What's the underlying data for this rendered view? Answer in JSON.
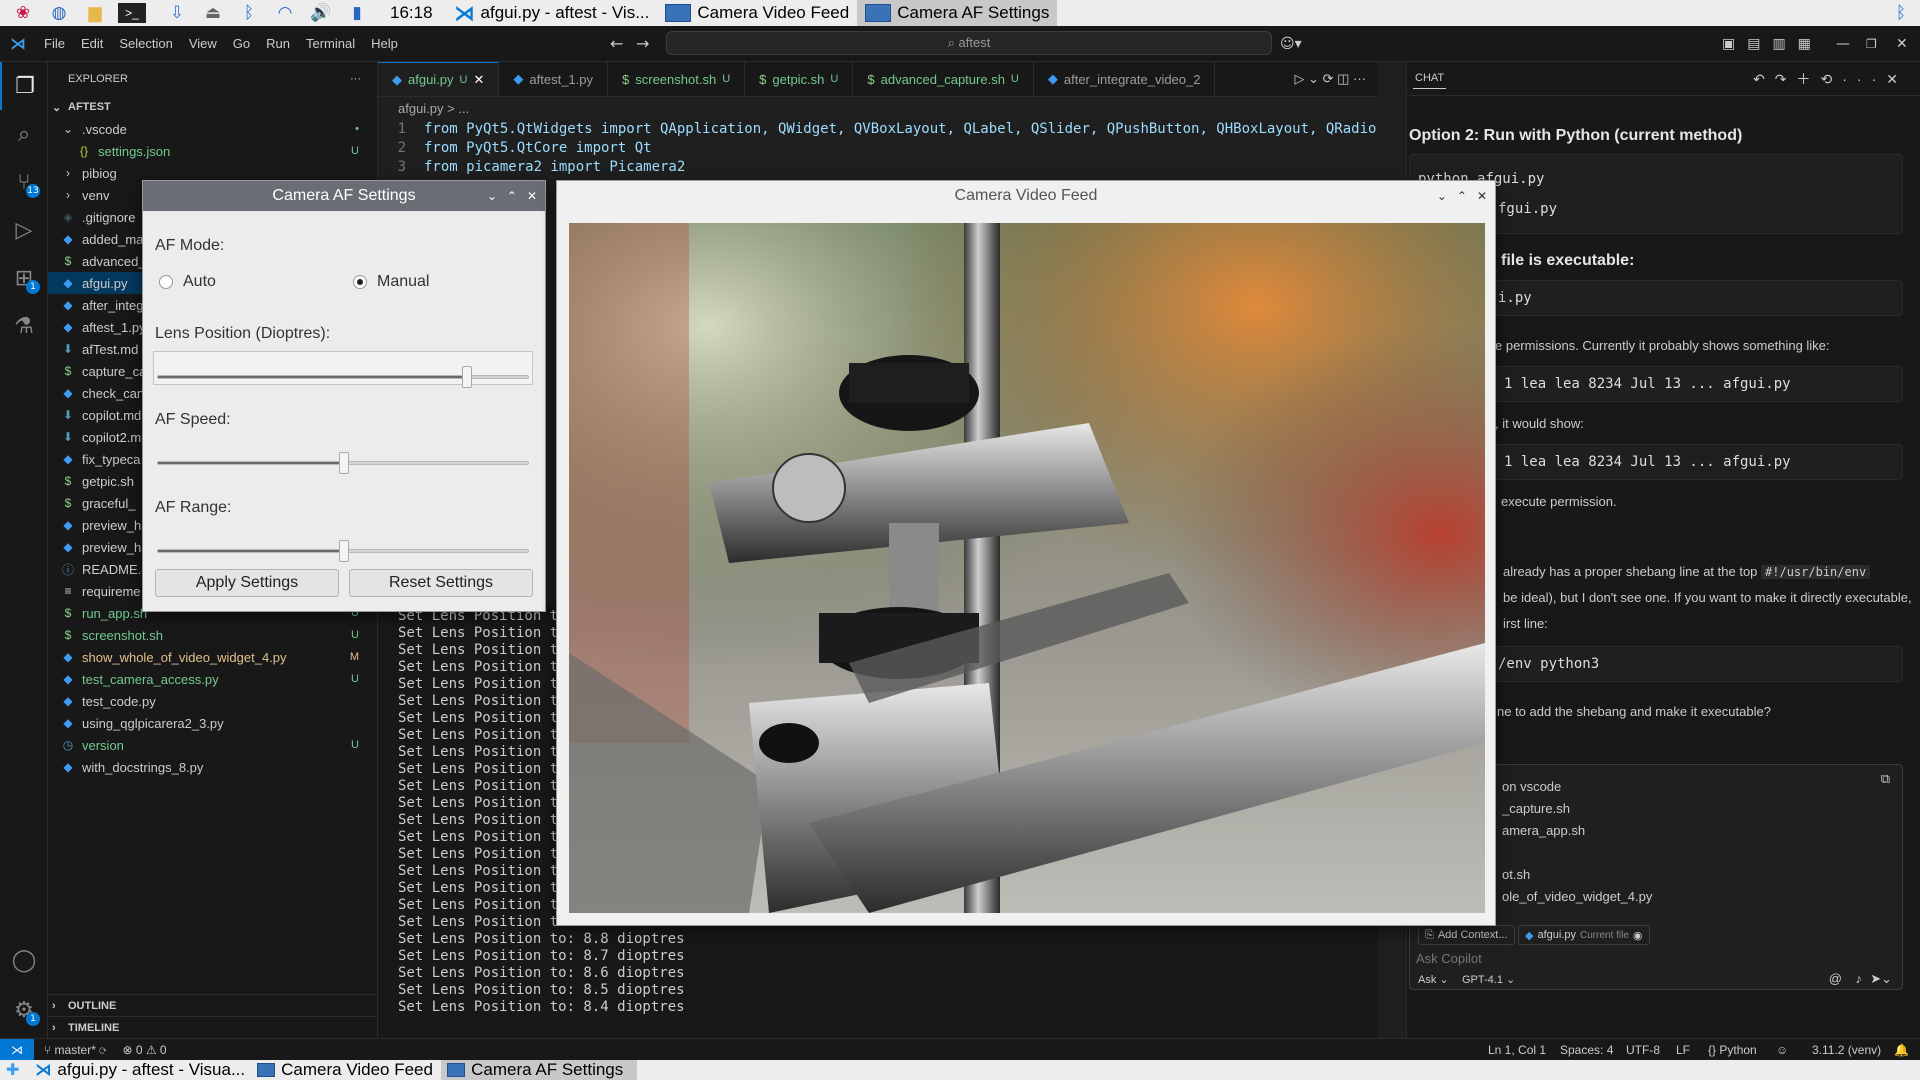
{
  "system_panel": {
    "clock": "16:18",
    "tasks": [
      {
        "label": "afgui.py - aftest - Vis..."
      },
      {
        "label": "Camera Video Feed"
      },
      {
        "label": "Camera AF Settings"
      }
    ]
  },
  "menu": [
    "File",
    "Edit",
    "Selection",
    "View",
    "Go",
    "Run",
    "Terminal",
    "Help"
  ],
  "command_center": "⌕ aftest",
  "explorer": {
    "title": "EXPLORER",
    "root": "AFTEST",
    "items": [
      {
        "label": ".vscode",
        "status": "•"
      },
      {
        "label": "settings.json",
        "status": "U"
      },
      {
        "label": "pibiog",
        "status": ""
      },
      {
        "label": "venv",
        "status": ""
      },
      {
        "label": ".gitignore",
        "status": ""
      },
      {
        "label": "added_ma",
        "status": ""
      },
      {
        "label": "advanced_",
        "status": ""
      },
      {
        "label": "afgui.py",
        "status": ""
      },
      {
        "label": "after_integ",
        "status": ""
      },
      {
        "label": "aftest_1.py",
        "status": ""
      },
      {
        "label": "afTest.md",
        "status": ""
      },
      {
        "label": "capture_ca",
        "status": ""
      },
      {
        "label": "check_can",
        "status": ""
      },
      {
        "label": "copilot.md",
        "status": ""
      },
      {
        "label": "copilot2.m",
        "status": ""
      },
      {
        "label": "fix_typeca",
        "status": ""
      },
      {
        "label": "getpic.sh",
        "status": ""
      },
      {
        "label": "graceful_",
        "status": ""
      },
      {
        "label": "preview_ha",
        "status": ""
      },
      {
        "label": "preview_ha",
        "status": ""
      },
      {
        "label": "README.m",
        "status": ""
      },
      {
        "label": "requireme",
        "status": ""
      },
      {
        "label": "run_app.sh",
        "status": "U"
      },
      {
        "label": "screenshot.sh",
        "status": "U"
      },
      {
        "label": "show_whole_of_video_widget_4.py",
        "status": "M"
      },
      {
        "label": "test_camera_access.py",
        "status": "U"
      },
      {
        "label": "test_code.py",
        "status": ""
      },
      {
        "label": "using_qglpicarera2_3.py",
        "status": ""
      },
      {
        "label": "version",
        "status": "U"
      },
      {
        "label": "with_docstrings_8.py",
        "status": ""
      }
    ],
    "outline": "OUTLINE",
    "timeline": "TIMELINE"
  },
  "editor": {
    "tabs": [
      {
        "label": "afgui.py",
        "status": "U"
      },
      {
        "label": "aftest_1.py",
        "status": ""
      },
      {
        "label": "screenshot.sh",
        "status": "U"
      },
      {
        "label": "getpic.sh",
        "status": "U"
      },
      {
        "label": "advanced_capture.sh",
        "status": "U"
      },
      {
        "label": "after_integrate_video_2",
        "status": ""
      }
    ],
    "breadcrumb": "afgui.py > ...",
    "code_lines": [
      {
        "num": "1",
        "text": "from PyQt5.QtWidgets import QApplication, QWidget, QVBoxLayout, QLabel, QSlider, QPushButton, QHBoxLayout, QRadio"
      },
      {
        "num": "2",
        "text": "from PyQt5.QtCore import Qt"
      },
      {
        "num": "3",
        "text": "from picamera2 import Picamera2"
      }
    ]
  },
  "terminal": {
    "partial_lines": [
      "Set Lens Position t",
      "Set Lens Position t",
      "Set Lens Position t",
      "Set Lens Position t",
      "Set Lens Position t",
      "Set Lens Position t",
      "Set Lens Position t",
      "Set Lens Position t",
      "Set Lens Position t",
      "Set Lens Position t",
      "Set Lens Position t",
      "Set Lens Position t",
      "Set Lens Position t",
      "Set Lens Position t",
      "Set Lens Position t",
      "Set Lens Position t",
      "Set Lens Position t",
      "Set Lens Position t",
      "Set Lens Position t"
    ],
    "lines": [
      "Set Lens Position to: 8.8 dioptres",
      "Set Lens Position to: 8.7 dioptres",
      "Set Lens Position to: 8.6 dioptres",
      "Set Lens Position to: 8.5 dioptres",
      "Set Lens Position to: 8.4 dioptres"
    ]
  },
  "chat": {
    "title": "CHAT",
    "heading": "Option 2: Run with Python (current method)",
    "code1": "python afgui.py",
    "code1b": "fgui.py",
    "heading2": "file is executable:",
    "code2": "i.py",
    "text1": "e permissions. Currently it probably shows something like:",
    "code3": "1 lea lea 8234 Jul 13 ... afgui.py",
    "text2": ", it would show:",
    "code4": "1 lea lea 8234 Jul 13 ... afgui.py",
    "text3": "execute permission.",
    "text4a": "already has a proper shebang line at the top",
    "text4code": "#!/usr/bin/env",
    "text4b": "be ideal), but I don't see one. If you want to make it directly executable,",
    "text4c": "irst line:",
    "code5": "/env python3",
    "text5": "ne to add the shebang and make it executable?",
    "refs": [
      "on  vscode",
      "_capture.sh",
      "amera_app.sh",
      "ot.sh",
      "ole_of_video_widget_4.py"
    ],
    "add_context": "Add Context...",
    "current_file": "afgui.py",
    "current_file_tag": "Current file",
    "placeholder": "Ask Copilot",
    "mode": "Ask",
    "model": "GPT-4.1"
  },
  "status": {
    "branch": "master*",
    "problems": "⊗ 0 ⚠ 0",
    "position": "Ln 1, Col 1",
    "spaces": "Spaces: 4",
    "encoding": "UTF-8",
    "eol": "LF",
    "language": "{} Python",
    "python": "3.11.2 (venv)"
  },
  "taskbar": [
    {
      "label": "afgui.py - aftest - Visua..."
    },
    {
      "label": "Camera Video Feed"
    },
    {
      "label": "Camera AF Settings"
    }
  ],
  "af_window": {
    "title": "Camera AF Settings",
    "af_mode_label": "AF Mode:",
    "auto_label": "Auto",
    "manual_label": "Manual",
    "selected_mode": "Manual",
    "lens_label": "Lens Position (Dioptres):",
    "lens_value_fraction": 0.84,
    "speed_label": "AF Speed:",
    "speed_value_fraction": 0.5,
    "range_label": "AF Range:",
    "range_value_fraction": 0.5,
    "apply_label": "Apply Settings",
    "reset_label": "Reset Settings"
  },
  "video_window": {
    "title": "Camera Video Feed"
  }
}
